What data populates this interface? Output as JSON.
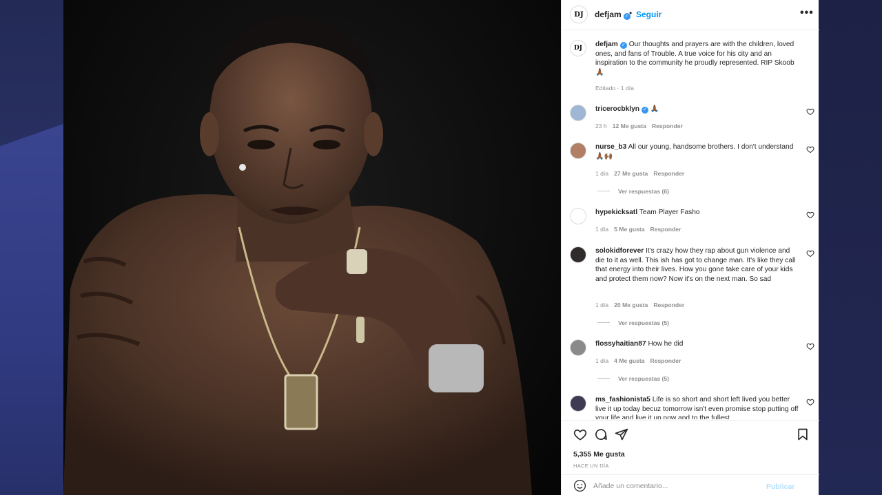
{
  "colors": {
    "accent": "#0095f6",
    "verified": "#3897f0",
    "muted": "#8e8e8e",
    "publish_disabled": "#b2dffc"
  },
  "header": {
    "avatar_text": "DJ",
    "username": "defjam",
    "separator": "•",
    "follow_label": "Seguir",
    "more_icon": "more-horizontal-icon"
  },
  "caption": {
    "avatar_text": "DJ",
    "username": "defjam",
    "text": "Our thoughts and prayers are with the children, loved ones, and fans of Trouble. A true voice for his city and an inspiration to the community he proudly represented. RIP Skoob🙏🏾",
    "meta": "Editado · 1 día"
  },
  "comments": [
    {
      "username": "tricerocbklyn",
      "verified": true,
      "text": "🙏🏾",
      "time": "23 h",
      "likes": "12 Me gusta",
      "reply": "Responder"
    },
    {
      "username": "nurse_b3",
      "text": "All our young, handsome brothers. I don't understand 🙏🏾🙌🏾",
      "time": "1 día",
      "likes": "27 Me gusta",
      "reply": "Responder",
      "view_replies": "Ver respuestas (6)"
    },
    {
      "username": "hypekicksatl",
      "text": "Team Player Fasho",
      "time": "1 día",
      "likes": "5 Me gusta",
      "reply": "Responder"
    },
    {
      "username": "solokidforever",
      "text": "It's crazy how they rap about gun violence and die to it as well. This ish has got to change man. It's like they call that energy into their lives. How you gone take care of your kids and protect them now? Now it's on the next man. So sad",
      "time": "1 día",
      "likes": "20 Me gusta",
      "reply": "Responder",
      "view_replies": "Ver respuestas (5)"
    },
    {
      "username": "flossyhaitian87",
      "text": "How he did",
      "time": "1 día",
      "likes": "4 Me gusta",
      "reply": "Responder",
      "view_replies": "Ver respuestas (5)"
    },
    {
      "username": "ms_fashionista5",
      "text": "Life is so short and short left lived you better live it up today becuz tomorrow isn't even promise stop putting off your life and live it up now and to the fullest",
      "time": "",
      "likes": "",
      "reply": ""
    }
  ],
  "actions": {
    "like_icon": "heart-icon",
    "comment_icon": "comment-icon",
    "share_icon": "share-icon",
    "save_icon": "bookmark-icon",
    "likes_count": "5,355 Me gusta",
    "time_ago": "HACE UN DÍA"
  },
  "add_comment": {
    "emoji_icon": "emoji-icon",
    "placeholder": "Añade un comentario...",
    "publish_label": "Publicar"
  }
}
